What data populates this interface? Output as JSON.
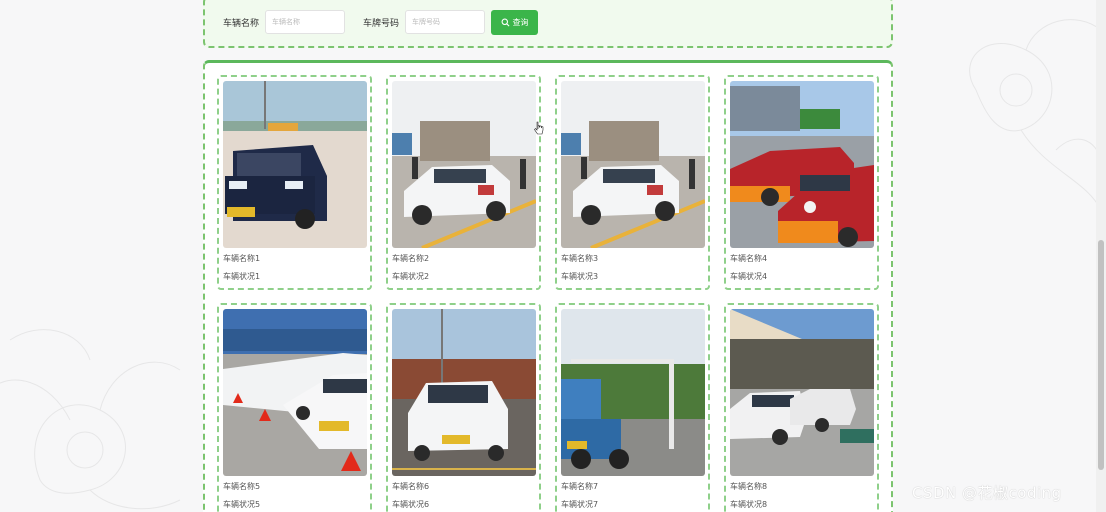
{
  "search": {
    "name_label": "车辆名称",
    "name_placeholder": "车辆名称",
    "plate_label": "车牌号码",
    "plate_placeholder": "车牌号码",
    "button_label": "查询",
    "button_icon": "search-icon"
  },
  "vehicles": [
    {
      "name": "车辆名称1",
      "status": "车辆状况1"
    },
    {
      "name": "车辆名称2",
      "status": "车辆状况2"
    },
    {
      "name": "车辆名称3",
      "status": "车辆状况3"
    },
    {
      "name": "车辆名称4",
      "status": "车辆状况4"
    },
    {
      "name": "车辆名称5",
      "status": "车辆状况5"
    },
    {
      "name": "车辆名称6",
      "status": "车辆状况6"
    },
    {
      "name": "车辆名称7",
      "status": "车辆状况7"
    },
    {
      "name": "车辆名称8",
      "status": "车辆状况8"
    }
  ],
  "watermark": "CSDN @花椒coding",
  "colors": {
    "accent_green": "#3bb54a",
    "border_green": "#7cc46f",
    "panel_bg": "#f1faee"
  }
}
